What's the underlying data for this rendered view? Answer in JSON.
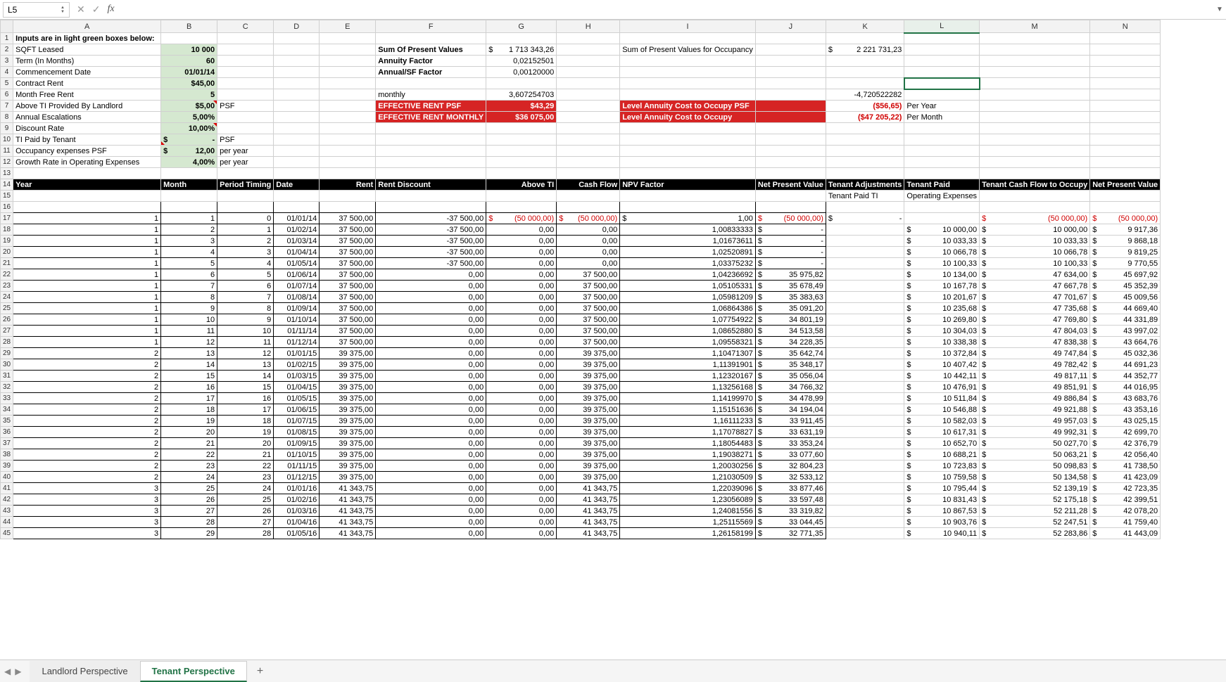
{
  "namebox": "L5",
  "formula": "",
  "columns": [
    "A",
    "B",
    "C",
    "D",
    "E",
    "F",
    "G",
    "H",
    "I",
    "J",
    "K",
    "L",
    "M",
    "N"
  ],
  "selected_col": "L",
  "selected_cell": "L5",
  "tabs": {
    "items": [
      "Landlord Perspective",
      "Tenant Perspective"
    ],
    "active": 1,
    "add": "+"
  },
  "inputs_header": "Inputs are in light green boxes below:",
  "labels": {
    "sqft": "SQFT Leased",
    "term": "Term (In Months)",
    "commence": "Commencement Date",
    "contract": "Contract Rent",
    "free": "Month Free Rent",
    "ti": "Above TI Provided By Landlord",
    "esc": "Annual Escalations",
    "disc": "Discount Rate",
    "tipaid": "TI Paid by Tenant",
    "occ": "Occupancy expenses PSF",
    "growth": "Growth Rate in Operating Expenses",
    "psf": "PSF",
    "peryear": "per year",
    "sumpv": "Sum Of Present Values",
    "annuity": "Annuity Factor",
    "annualsf": "Annual/SF Factor",
    "monthly": "monthly",
    "effpsf": "EFFECTIVE RENT PSF",
    "effmon": "EFFECTIVE RENT MONTHLY",
    "sumpvocc": "Sum of Present Values for Occupancy",
    "levelpsf": "Level Annuity Cost to Occupy PSF",
    "level": "Level Annuity Cost to Occupy",
    "PerYear": "Per Year",
    "PerMonth": "Per Month",
    "tenadj": "Tenant Adjustments",
    "tenpaid": "Tenant Paid",
    "tcfto": "Tenant Cash Flow to Occupy",
    "npv2": "Net Present Value",
    "tenpaidti": "Tenant Paid TI",
    "opex": "Operating Expenses"
  },
  "vals": {
    "sqft": "10 000",
    "term": "60",
    "commence": "01/01/14",
    "contract": "$45,00",
    "free": "5",
    "ti": "$5,00",
    "esc": "5,00%",
    "disc": "10,00%",
    "tipaid_dollar": "$",
    "tipaid_val": "-",
    "occ_dollar": "$",
    "occ_val": "12,00",
    "growth": "4,00%",
    "sumpv_dollar": "$",
    "sumpv_val": "1 713 343,26",
    "annuity": "0,02152501",
    "annualsf": "0,00120000",
    "monthly": "3,607254703",
    "effpsf": "$43,29",
    "effmon": "$36 075,00",
    "sumpvocc_dollar": "$",
    "sumpvocc_val": "2 221 731,23",
    "neg": "-4,720522282",
    "levelpsf": "($56,65)",
    "level": "($47 205,22)"
  },
  "table_hdr": {
    "year": "Year",
    "month": "Month",
    "period": "Period Timing",
    "date": "Date",
    "rent": "Rent",
    "disc": "Rent Discount",
    "ti": "Above TI",
    "cf": "Cash Flow",
    "npvf": "NPV Factor",
    "npv": "Net Present Value"
  },
  "rows": [
    {
      "r": 17,
      "y": "1",
      "m": "1",
      "p": "0",
      "d": "01/01/14",
      "rent": "37 500,00",
      "rd": "-37 500,00",
      "ti_d": "$",
      "ti": "(50 000,00)",
      "cf_d": "$",
      "cf": "(50 000,00)",
      "f_d": "$",
      "f": "1,00",
      "npv_d": "$",
      "npv": "(50 000,00)",
      "adj_d": "$",
      "adj": "-",
      "op_d": "",
      "op": "",
      "tcf_d": "$",
      "tcf": "(50 000,00)",
      "np2_d": "$",
      "np2": "(50 000,00)"
    },
    {
      "r": 18,
      "y": "1",
      "m": "2",
      "p": "1",
      "d": "01/02/14",
      "rent": "37 500,00",
      "rd": "-37 500,00",
      "ti": "0,00",
      "cf": "0,00",
      "f": "1,00833333",
      "npv_d": "$",
      "npv": "-",
      "op_d": "$",
      "op": "10 000,00",
      "tcf_d": "$",
      "tcf": "10 000,00",
      "np2_d": "$",
      "np2": "9 917,36"
    },
    {
      "r": 19,
      "y": "1",
      "m": "3",
      "p": "2",
      "d": "01/03/14",
      "rent": "37 500,00",
      "rd": "-37 500,00",
      "ti": "0,00",
      "cf": "0,00",
      "f": "1,01673611",
      "npv_d": "$",
      "npv": "-",
      "op_d": "$",
      "op": "10 033,33",
      "tcf_d": "$",
      "tcf": "10 033,33",
      "np2_d": "$",
      "np2": "9 868,18"
    },
    {
      "r": 20,
      "y": "1",
      "m": "4",
      "p": "3",
      "d": "01/04/14",
      "rent": "37 500,00",
      "rd": "-37 500,00",
      "ti": "0,00",
      "cf": "0,00",
      "f": "1,02520891",
      "npv_d": "$",
      "npv": "-",
      "op_d": "$",
      "op": "10 066,78",
      "tcf_d": "$",
      "tcf": "10 066,78",
      "np2_d": "$",
      "np2": "9 819,25"
    },
    {
      "r": 21,
      "y": "1",
      "m": "5",
      "p": "4",
      "d": "01/05/14",
      "rent": "37 500,00",
      "rd": "-37 500,00",
      "ti": "0,00",
      "cf": "0,00",
      "f": "1,03375232",
      "npv_d": "$",
      "npv": "-",
      "op_d": "$",
      "op": "10 100,33",
      "tcf_d": "$",
      "tcf": "10 100,33",
      "np2_d": "$",
      "np2": "9 770,55"
    },
    {
      "r": 22,
      "y": "1",
      "m": "6",
      "p": "5",
      "d": "01/06/14",
      "rent": "37 500,00",
      "rd": "0,00",
      "ti": "0,00",
      "cf": "37 500,00",
      "f": "1,04236692",
      "npv_d": "$",
      "npv": "35 975,82",
      "op_d": "$",
      "op": "10 134,00",
      "tcf_d": "$",
      "tcf": "47 634,00",
      "np2_d": "$",
      "np2": "45 697,92"
    },
    {
      "r": 23,
      "y": "1",
      "m": "7",
      "p": "6",
      "d": "01/07/14",
      "rent": "37 500,00",
      "rd": "0,00",
      "ti": "0,00",
      "cf": "37 500,00",
      "f": "1,05105331",
      "npv_d": "$",
      "npv": "35 678,49",
      "op_d": "$",
      "op": "10 167,78",
      "tcf_d": "$",
      "tcf": "47 667,78",
      "np2_d": "$",
      "np2": "45 352,39"
    },
    {
      "r": 24,
      "y": "1",
      "m": "8",
      "p": "7",
      "d": "01/08/14",
      "rent": "37 500,00",
      "rd": "0,00",
      "ti": "0,00",
      "cf": "37 500,00",
      "f": "1,05981209",
      "npv_d": "$",
      "npv": "35 383,63",
      "op_d": "$",
      "op": "10 201,67",
      "tcf_d": "$",
      "tcf": "47 701,67",
      "np2_d": "$",
      "np2": "45 009,56"
    },
    {
      "r": 25,
      "y": "1",
      "m": "9",
      "p": "8",
      "d": "01/09/14",
      "rent": "37 500,00",
      "rd": "0,00",
      "ti": "0,00",
      "cf": "37 500,00",
      "f": "1,06864386",
      "npv_d": "$",
      "npv": "35 091,20",
      "op_d": "$",
      "op": "10 235,68",
      "tcf_d": "$",
      "tcf": "47 735,68",
      "np2_d": "$",
      "np2": "44 669,40"
    },
    {
      "r": 26,
      "y": "1",
      "m": "10",
      "p": "9",
      "d": "01/10/14",
      "rent": "37 500,00",
      "rd": "0,00",
      "ti": "0,00",
      "cf": "37 500,00",
      "f": "1,07754922",
      "npv_d": "$",
      "npv": "34 801,19",
      "op_d": "$",
      "op": "10 269,80",
      "tcf_d": "$",
      "tcf": "47 769,80",
      "np2_d": "$",
      "np2": "44 331,89"
    },
    {
      "r": 27,
      "y": "1",
      "m": "11",
      "p": "10",
      "d": "01/11/14",
      "rent": "37 500,00",
      "rd": "0,00",
      "ti": "0,00",
      "cf": "37 500,00",
      "f": "1,08652880",
      "npv_d": "$",
      "npv": "34 513,58",
      "op_d": "$",
      "op": "10 304,03",
      "tcf_d": "$",
      "tcf": "47 804,03",
      "np2_d": "$",
      "np2": "43 997,02"
    },
    {
      "r": 28,
      "y": "1",
      "m": "12",
      "p": "11",
      "d": "01/12/14",
      "rent": "37 500,00",
      "rd": "0,00",
      "ti": "0,00",
      "cf": "37 500,00",
      "f": "1,09558321",
      "npv_d": "$",
      "npv": "34 228,35",
      "op_d": "$",
      "op": "10 338,38",
      "tcf_d": "$",
      "tcf": "47 838,38",
      "np2_d": "$",
      "np2": "43 664,76"
    },
    {
      "r": 29,
      "y": "2",
      "m": "13",
      "p": "12",
      "d": "01/01/15",
      "rent": "39 375,00",
      "rd": "0,00",
      "ti": "0,00",
      "cf": "39 375,00",
      "f": "1,10471307",
      "npv_d": "$",
      "npv": "35 642,74",
      "op_d": "$",
      "op": "10 372,84",
      "tcf_d": "$",
      "tcf": "49 747,84",
      "np2_d": "$",
      "np2": "45 032,36"
    },
    {
      "r": 30,
      "y": "2",
      "m": "14",
      "p": "13",
      "d": "01/02/15",
      "rent": "39 375,00",
      "rd": "0,00",
      "ti": "0,00",
      "cf": "39 375,00",
      "f": "1,11391901",
      "npv_d": "$",
      "npv": "35 348,17",
      "op_d": "$",
      "op": "10 407,42",
      "tcf_d": "$",
      "tcf": "49 782,42",
      "np2_d": "$",
      "np2": "44 691,23"
    },
    {
      "r": 31,
      "y": "2",
      "m": "15",
      "p": "14",
      "d": "01/03/15",
      "rent": "39 375,00",
      "rd": "0,00",
      "ti": "0,00",
      "cf": "39 375,00",
      "f": "1,12320167",
      "npv_d": "$",
      "npv": "35 056,04",
      "op_d": "$",
      "op": "10 442,11",
      "tcf_d": "$",
      "tcf": "49 817,11",
      "np2_d": "$",
      "np2": "44 352,77"
    },
    {
      "r": 32,
      "y": "2",
      "m": "16",
      "p": "15",
      "d": "01/04/15",
      "rent": "39 375,00",
      "rd": "0,00",
      "ti": "0,00",
      "cf": "39 375,00",
      "f": "1,13256168",
      "npv_d": "$",
      "npv": "34 766,32",
      "op_d": "$",
      "op": "10 476,91",
      "tcf_d": "$",
      "tcf": "49 851,91",
      "np2_d": "$",
      "np2": "44 016,95"
    },
    {
      "r": 33,
      "y": "2",
      "m": "17",
      "p": "16",
      "d": "01/05/15",
      "rent": "39 375,00",
      "rd": "0,00",
      "ti": "0,00",
      "cf": "39 375,00",
      "f": "1,14199970",
      "npv_d": "$",
      "npv": "34 478,99",
      "op_d": "$",
      "op": "10 511,84",
      "tcf_d": "$",
      "tcf": "49 886,84",
      "np2_d": "$",
      "np2": "43 683,76"
    },
    {
      "r": 34,
      "y": "2",
      "m": "18",
      "p": "17",
      "d": "01/06/15",
      "rent": "39 375,00",
      "rd": "0,00",
      "ti": "0,00",
      "cf": "39 375,00",
      "f": "1,15151636",
      "npv_d": "$",
      "npv": "34 194,04",
      "op_d": "$",
      "op": "10 546,88",
      "tcf_d": "$",
      "tcf": "49 921,88",
      "np2_d": "$",
      "np2": "43 353,16"
    },
    {
      "r": 35,
      "y": "2",
      "m": "19",
      "p": "18",
      "d": "01/07/15",
      "rent": "39 375,00",
      "rd": "0,00",
      "ti": "0,00",
      "cf": "39 375,00",
      "f": "1,16111233",
      "npv_d": "$",
      "npv": "33 911,45",
      "op_d": "$",
      "op": "10 582,03",
      "tcf_d": "$",
      "tcf": "49 957,03",
      "np2_d": "$",
      "np2": "43 025,15"
    },
    {
      "r": 36,
      "y": "2",
      "m": "20",
      "p": "19",
      "d": "01/08/15",
      "rent": "39 375,00",
      "rd": "0,00",
      "ti": "0,00",
      "cf": "39 375,00",
      "f": "1,17078827",
      "npv_d": "$",
      "npv": "33 631,19",
      "op_d": "$",
      "op": "10 617,31",
      "tcf_d": "$",
      "tcf": "49 992,31",
      "np2_d": "$",
      "np2": "42 699,70"
    },
    {
      "r": 37,
      "y": "2",
      "m": "21",
      "p": "20",
      "d": "01/09/15",
      "rent": "39 375,00",
      "rd": "0,00",
      "ti": "0,00",
      "cf": "39 375,00",
      "f": "1,18054483",
      "npv_d": "$",
      "npv": "33 353,24",
      "op_d": "$",
      "op": "10 652,70",
      "tcf_d": "$",
      "tcf": "50 027,70",
      "np2_d": "$",
      "np2": "42 376,79"
    },
    {
      "r": 38,
      "y": "2",
      "m": "22",
      "p": "21",
      "d": "01/10/15",
      "rent": "39 375,00",
      "rd": "0,00",
      "ti": "0,00",
      "cf": "39 375,00",
      "f": "1,19038271",
      "npv_d": "$",
      "npv": "33 077,60",
      "op_d": "$",
      "op": "10 688,21",
      "tcf_d": "$",
      "tcf": "50 063,21",
      "np2_d": "$",
      "np2": "42 056,40"
    },
    {
      "r": 39,
      "y": "2",
      "m": "23",
      "p": "22",
      "d": "01/11/15",
      "rent": "39 375,00",
      "rd": "0,00",
      "ti": "0,00",
      "cf": "39 375,00",
      "f": "1,20030256",
      "npv_d": "$",
      "npv": "32 804,23",
      "op_d": "$",
      "op": "10 723,83",
      "tcf_d": "$",
      "tcf": "50 098,83",
      "np2_d": "$",
      "np2": "41 738,50"
    },
    {
      "r": 40,
      "y": "2",
      "m": "24",
      "p": "23",
      "d": "01/12/15",
      "rent": "39 375,00",
      "rd": "0,00",
      "ti": "0,00",
      "cf": "39 375,00",
      "f": "1,21030509",
      "npv_d": "$",
      "npv": "32 533,12",
      "op_d": "$",
      "op": "10 759,58",
      "tcf_d": "$",
      "tcf": "50 134,58",
      "np2_d": "$",
      "np2": "41 423,09"
    },
    {
      "r": 41,
      "y": "3",
      "m": "25",
      "p": "24",
      "d": "01/01/16",
      "rent": "41 343,75",
      "rd": "0,00",
      "ti": "0,00",
      "cf": "41 343,75",
      "f": "1,22039096",
      "npv_d": "$",
      "npv": "33 877,46",
      "op_d": "$",
      "op": "10 795,44",
      "tcf_d": "$",
      "tcf": "52 139,19",
      "np2_d": "$",
      "np2": "42 723,35"
    },
    {
      "r": 42,
      "y": "3",
      "m": "26",
      "p": "25",
      "d": "01/02/16",
      "rent": "41 343,75",
      "rd": "0,00",
      "ti": "0,00",
      "cf": "41 343,75",
      "f": "1,23056089",
      "npv_d": "$",
      "npv": "33 597,48",
      "op_d": "$",
      "op": "10 831,43",
      "tcf_d": "$",
      "tcf": "52 175,18",
      "np2_d": "$",
      "np2": "42 399,51"
    },
    {
      "r": 43,
      "y": "3",
      "m": "27",
      "p": "26",
      "d": "01/03/16",
      "rent": "41 343,75",
      "rd": "0,00",
      "ti": "0,00",
      "cf": "41 343,75",
      "f": "1,24081556",
      "npv_d": "$",
      "npv": "33 319,82",
      "op_d": "$",
      "op": "10 867,53",
      "tcf_d": "$",
      "tcf": "52 211,28",
      "np2_d": "$",
      "np2": "42 078,20"
    },
    {
      "r": 44,
      "y": "3",
      "m": "28",
      "p": "27",
      "d": "01/04/16",
      "rent": "41 343,75",
      "rd": "0,00",
      "ti": "0,00",
      "cf": "41 343,75",
      "f": "1,25115569",
      "npv_d": "$",
      "npv": "33 044,45",
      "op_d": "$",
      "op": "10 903,76",
      "tcf_d": "$",
      "tcf": "52 247,51",
      "np2_d": "$",
      "np2": "41 759,40"
    },
    {
      "r": 45,
      "y": "3",
      "m": "29",
      "p": "28",
      "d": "01/05/16",
      "rent": "41 343,75",
      "rd": "0,00",
      "ti": "0,00",
      "cf": "41 343,75",
      "f": "1,26158199",
      "npv_d": "$",
      "npv": "32 771,35",
      "op_d": "$",
      "op": "10 940,11",
      "tcf_d": "$",
      "tcf": "52 283,86",
      "np2_d": "$",
      "np2": "41 443,09"
    }
  ]
}
